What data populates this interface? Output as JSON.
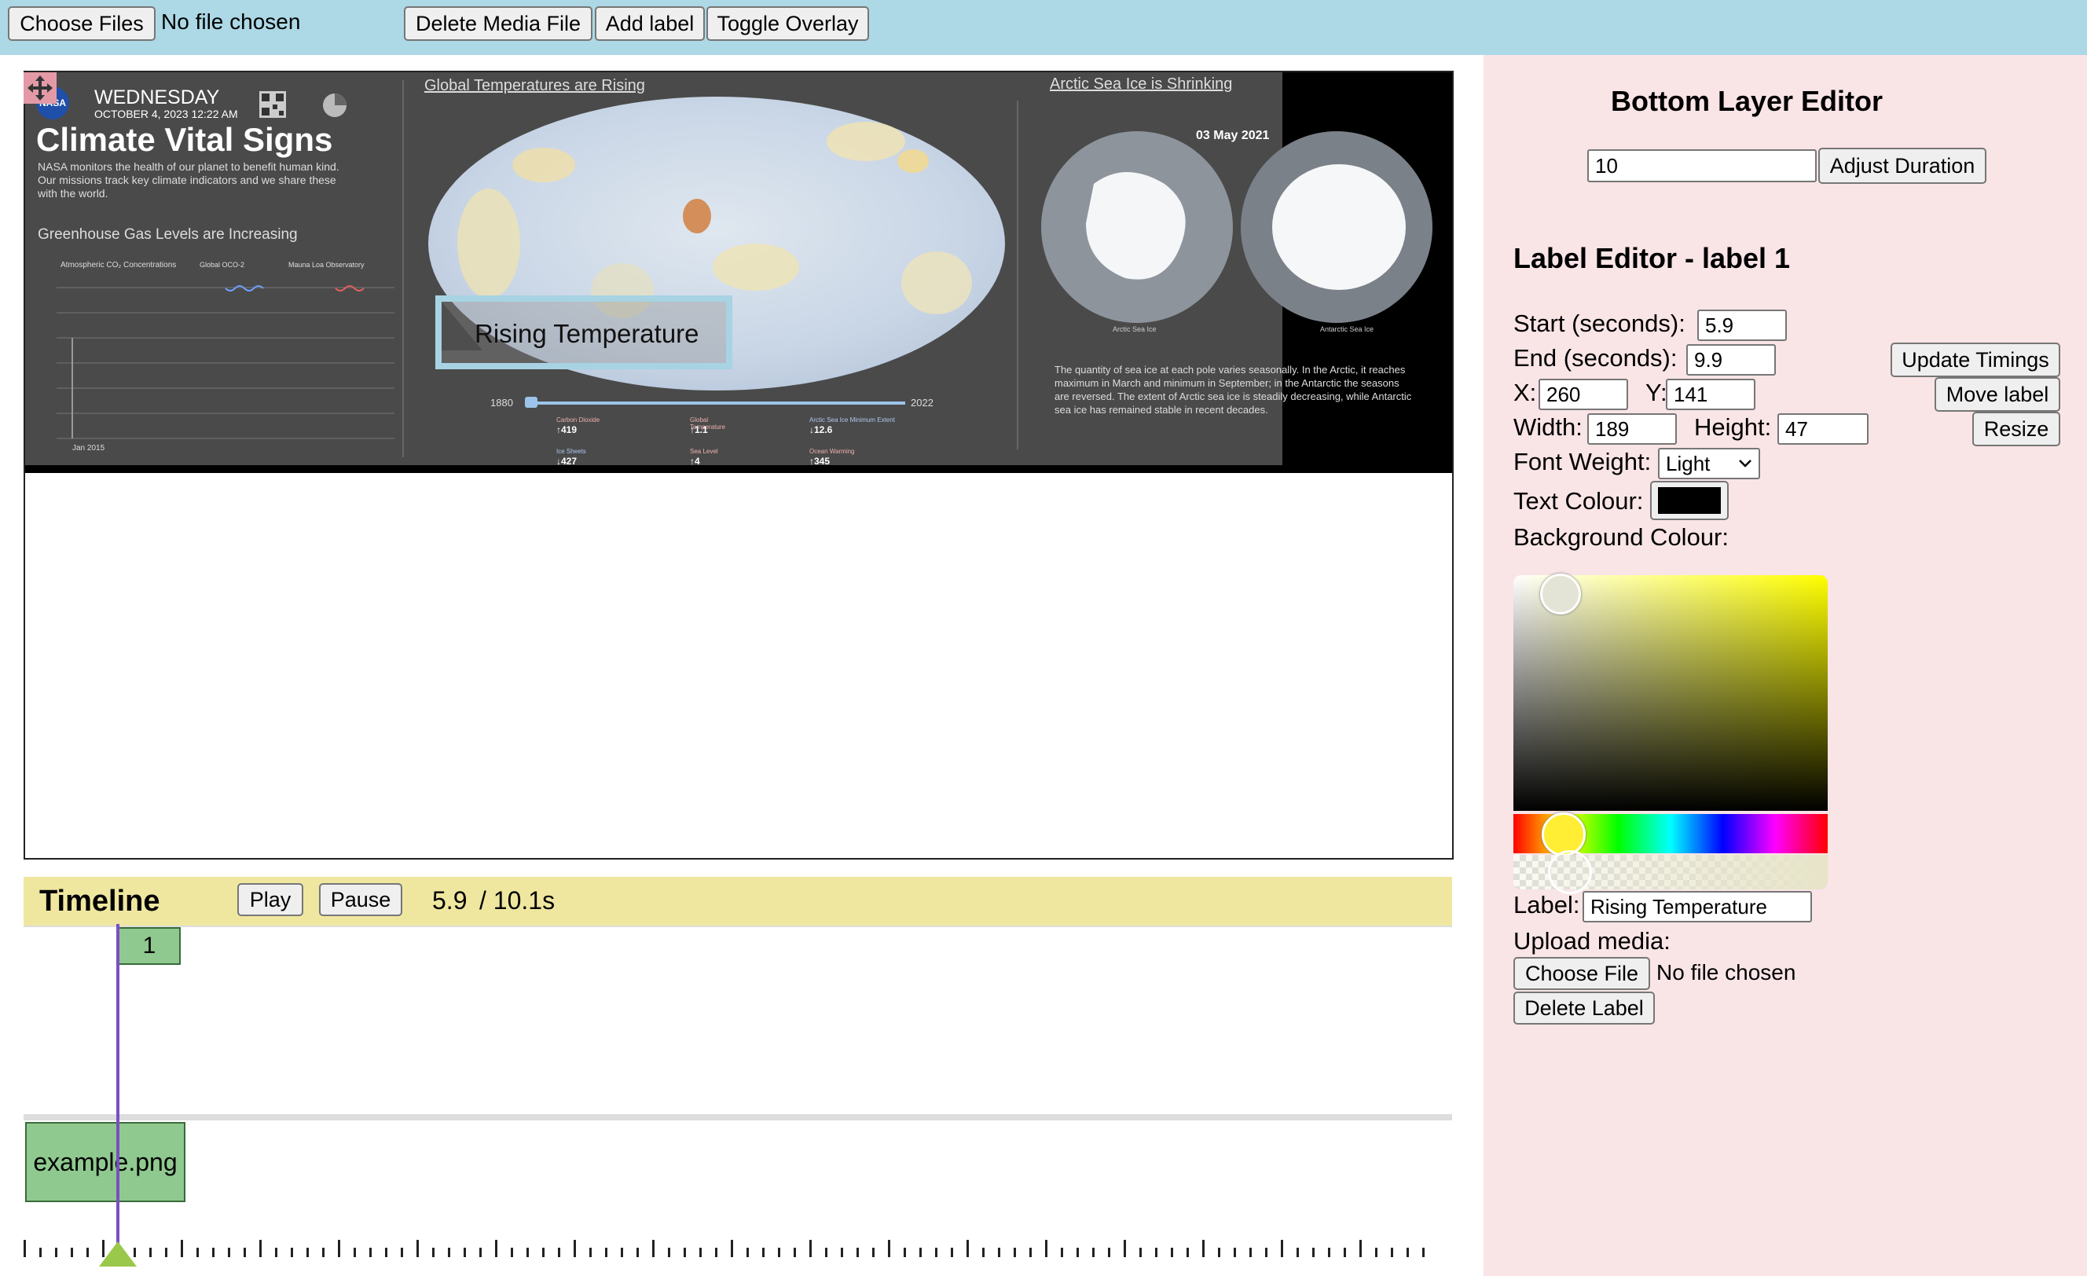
{
  "topbar": {
    "choose_files": "Choose Files",
    "no_file": "No file chosen",
    "delete_media": "Delete Media File",
    "add_label": "Add label",
    "toggle_overlay": "Toggle Overlay"
  },
  "slide": {
    "logo": "NASA",
    "day": "WEDNESDAY",
    "date": "OCTOBER 4, 2023   12:22 AM",
    "title": "Climate Vital Signs",
    "intro": "NASA monitors the health of our planet to benefit human kind. Our missions track key climate indicators and we share these with the world.",
    "ghg_title": "Greenhouse Gas Levels are Increasing",
    "ghg_legend_1": "Atmospheric CO₂ Concentrations",
    "ghg_legend_2": "Global OCO-2",
    "ghg_legend_3": "Mauna Loa Observatory",
    "ghg_start": "Jan 2015",
    "temp_title": "Global Temperatures are Rising",
    "year_start": "1880",
    "year_end": "2022",
    "ice_title": "Arctic Sea Ice is Shrinking",
    "ice_date": "03 May 2021",
    "arctic_label": "Arctic Sea Ice",
    "antarctic_label": "Antarctic Sea Ice",
    "ice_text": "The quantity of sea ice at each pole varies seasonally. In the Arctic, it reaches maximum in March and minimum in September; in the Antarctic the seasons are reversed. The extent of Arctic sea ice is steadily decreasing, while Antarctic sea ice has remained stable in recent decades.",
    "stats": [
      {
        "name": "Carbon Dioxide",
        "value": "↑419"
      },
      {
        "name": "Global Temperature",
        "value": "↑1.1"
      },
      {
        "name": "Arctic Sea Ice Minimum Extent",
        "value": "↓12.6"
      },
      {
        "name": "Ice Sheets",
        "value": "↓427"
      },
      {
        "name": "Sea Level",
        "value": "↑4"
      },
      {
        "name": "Ocean Warming",
        "value": "↑345"
      }
    ]
  },
  "overlay_label": "Rising Temperature",
  "timeline": {
    "title": "Timeline",
    "play": "Play",
    "pause": "Pause",
    "current": "5.9",
    "total": "/ 10.1s",
    "label_clip": "1",
    "media_clip": "example.png"
  },
  "bottom_editor": {
    "title": "Bottom Layer Editor",
    "duration": "10",
    "adjust": "Adjust Duration"
  },
  "label_editor": {
    "title": "Label Editor - label 1",
    "start_label": "Start (seconds):",
    "start": "5.9",
    "end_label": "End (seconds):",
    "end": "9.9",
    "update": "Update Timings",
    "x_label": "X:",
    "x": "260",
    "y_label": "Y:",
    "y": "141",
    "move": "Move label",
    "width_label": "Width:",
    "width": "189",
    "height_label": "Height:",
    "height": "47",
    "resize": "Resize",
    "font_weight_label": "Font Weight:",
    "font_weight": "Light",
    "text_colour_label": "Text Colour:",
    "text_colour": "#000000",
    "bg_colour_label": "Background Colour:",
    "label_label": "Label:",
    "label": "Rising Temperature",
    "upload_label": "Upload media:",
    "choose_file": "Choose File",
    "no_file": "No file chosen",
    "delete": "Delete Label"
  },
  "colors": {
    "topbar": "#add8e6",
    "panel": "#f9e4e6",
    "timeline": "#efe7a0",
    "clip": "#8fc98f",
    "playhead": "#7a4fc0"
  }
}
